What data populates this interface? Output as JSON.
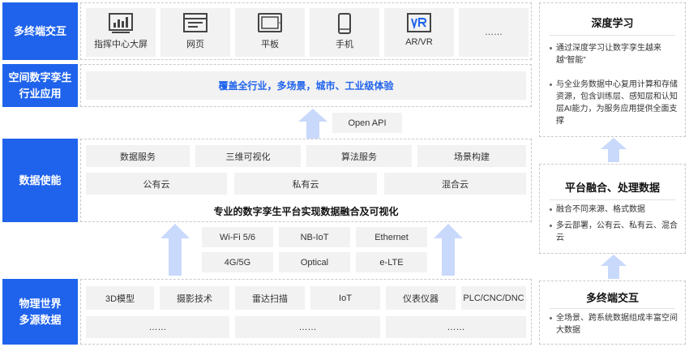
{
  "rows": {
    "terminal": {
      "label": "多终端交互",
      "devices": [
        {
          "label": "指挥中心大屏",
          "icon": "bar-chart-screen-icon"
        },
        {
          "label": "网页",
          "icon": "browser-window-icon"
        },
        {
          "label": "平板",
          "icon": "tablet-icon"
        },
        {
          "label": "手机",
          "icon": "phone-icon"
        },
        {
          "label": "AR/VR",
          "icon": "vr-headset-icon"
        },
        {
          "label": "……",
          "icon": ""
        }
      ]
    },
    "industry": {
      "label_line1": "空间数字孪生",
      "label_line2": "行业应用",
      "banner": "覆盖全行业，多场景，城市、工业级体验",
      "api": "Open API"
    },
    "data": {
      "label": "数据使能",
      "services": [
        "数据服务",
        "三维可视化",
        "算法服务",
        "场景构建"
      ],
      "clouds": [
        "公有云",
        "私有云",
        "混合云"
      ],
      "caption": "专业的数字孪生平台实现数据融合及可视化"
    },
    "protocols": [
      "Wi-Fi 5/6",
      "NB-IoT",
      "Ethernet",
      "4G/5G",
      "Optical",
      "e-LTE"
    ],
    "physical": {
      "label_line1": "物理世界",
      "label_line2": "多源数据",
      "sources": [
        "3D模型",
        "摄影技术",
        "雷达扫描",
        "IoT",
        "仪表仪器",
        "PLC/CNC/DNC"
      ],
      "more": [
        "……",
        "……",
        "……"
      ]
    }
  },
  "right": {
    "deep": {
      "title": "深度学习",
      "bullets": [
        "通过深度学习让数字孪生越来越“智能”",
        "与全业务数据中心复用计算和存储资源，包含训练层、感知层和认知层AI能力，为服务应用提供全面支撑"
      ]
    },
    "fusion": {
      "title": "平台融合、处理数据",
      "bullets": [
        "融合不同来源、格式数据",
        "多云部署，公有云、私有云、混合云"
      ]
    },
    "interaction": {
      "title": "多终端交互",
      "bullets": [
        "全场景、跨系统数据组成丰富空间大数据"
      ]
    }
  },
  "colors": {
    "accent": "#1f63ec",
    "arrow": "#c9d9fb",
    "tile": "#f2f2f2"
  }
}
